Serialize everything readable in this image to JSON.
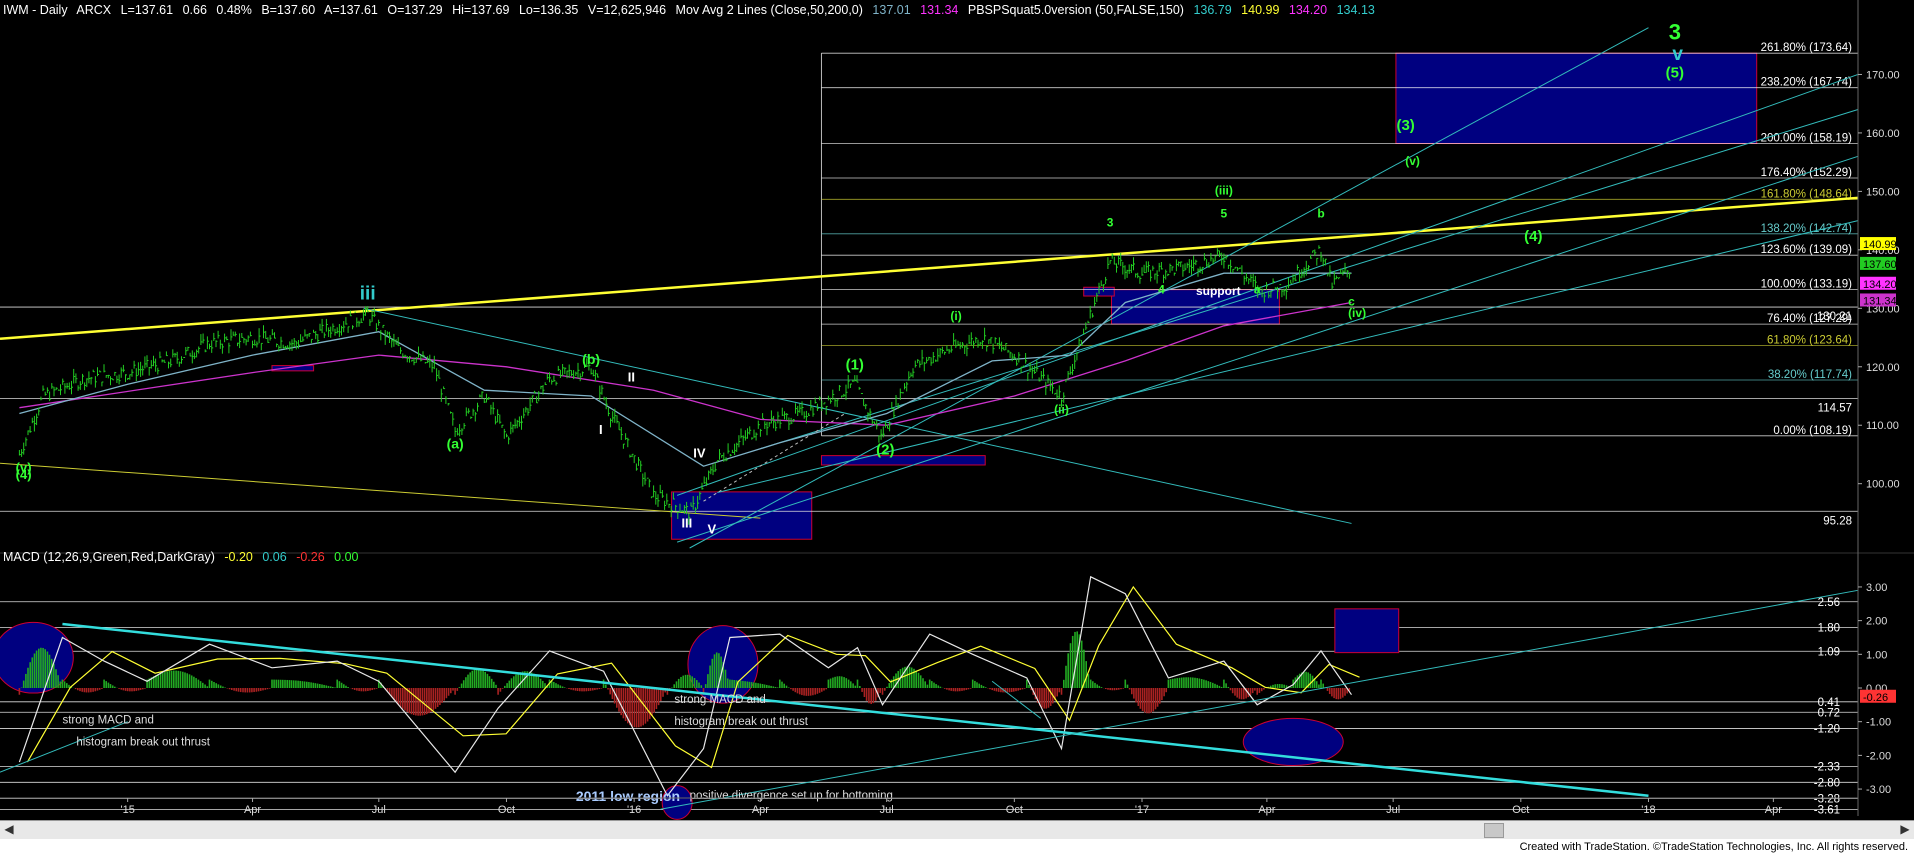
{
  "header": {
    "symbol": "IWM - Daily",
    "exchange": "ARCX",
    "last": "L=137.61",
    "change": "0.66",
    "pct": "0.48%",
    "bid": "B=137.60",
    "ask": "A=137.61",
    "open": "O=137.29",
    "high": "Hi=137.69",
    "low": "Lo=136.35",
    "volume": "V=12,625,946",
    "ma_title": "Mov Avg 2 Lines (Close,50,200,0)",
    "ma_v1": "137.01",
    "ma_v2": "131.34",
    "ind_title": "PBSPSquat5.0version (50,FALSE,150)",
    "ind_v1": "136.79",
    "ind_v2": "140.99",
    "ind_v3": "134.20",
    "ind_v4": "134.13"
  },
  "macd_header": {
    "title": "MACD (12,26,9,Green,Red,DarkGray)",
    "v1": "-0.20",
    "v2": "0.06",
    "v3": "-0.26",
    "v4": "0.00"
  },
  "footer": {
    "text": "Created with TradeStation. ©TradeStation Technologies, Inc. All rights reserved."
  },
  "colors": {
    "price": "#22cc22",
    "fib": "#ffffff",
    "trendline": "#ffff33",
    "channel": "#33bbbb",
    "ma50": "#7fb3c8",
    "ma200": "#cc33cc",
    "box_fill": "#000080",
    "box_stroke": "#cc0033",
    "label_green": "#33ff33",
    "macd_line": "#e8e8e8",
    "signal_line": "#ffff33",
    "hist_pos": "#22aa22",
    "hist_neg": "#aa2222"
  },
  "chart_data": [
    {
      "type": "candlestick",
      "title": "IWM - Daily",
      "x_ticks": [
        "'15",
        "Apr",
        "Jul",
        "Oct",
        "'16",
        "Apr",
        "Jul",
        "Oct",
        "'17",
        "Apr",
        "Jul",
        "Oct",
        "'18",
        "Apr"
      ],
      "y_ticks": [
        100,
        110,
        120,
        130,
        140,
        150,
        160,
        170
      ],
      "ylim": [
        89,
        180
      ],
      "close_path": [
        {
          "d": "2014-10-15",
          "v": 105
        },
        {
          "d": "2014-11-01",
          "v": 115
        },
        {
          "d": "2014-12-01",
          "v": 118
        },
        {
          "d": "2015-01-01",
          "v": 119
        },
        {
          "d": "2015-02-01",
          "v": 121
        },
        {
          "d": "2015-03-01",
          "v": 124
        },
        {
          "d": "2015-04-01",
          "v": 125
        },
        {
          "d": "2015-05-01",
          "v": 124
        },
        {
          "d": "2015-06-01",
          "v": 127
        },
        {
          "d": "2015-06-23",
          "v": 129
        },
        {
          "d": "2015-07-15",
          "v": 123
        },
        {
          "d": "2015-08-10",
          "v": 120
        },
        {
          "d": "2015-08-25",
          "v": 109
        },
        {
          "d": "2015-09-15",
          "v": 115
        },
        {
          "d": "2015-10-01",
          "v": 108
        },
        {
          "d": "2015-11-01",
          "v": 118
        },
        {
          "d": "2015-12-01",
          "v": 120
        },
        {
          "d": "2015-12-15",
          "v": 112
        },
        {
          "d": "2016-01-15",
          "v": 98
        },
        {
          "d": "2016-02-11",
          "v": 95
        },
        {
          "d": "2016-03-01",
          "v": 104
        },
        {
          "d": "2016-04-01",
          "v": 110
        },
        {
          "d": "2016-05-01",
          "v": 112
        },
        {
          "d": "2016-06-08",
          "v": 117
        },
        {
          "d": "2016-06-27",
          "v": 108
        },
        {
          "d": "2016-07-20",
          "v": 120
        },
        {
          "d": "2016-08-15",
          "v": 123
        },
        {
          "d": "2016-09-08",
          "v": 125
        },
        {
          "d": "2016-10-01",
          "v": 122
        },
        {
          "d": "2016-11-04",
          "v": 115
        },
        {
          "d": "2016-12-01",
          "v": 133
        },
        {
          "d": "2016-12-09",
          "v": 138
        },
        {
          "d": "2017-01-01",
          "v": 136
        },
        {
          "d": "2017-02-01",
          "v": 137
        },
        {
          "d": "2017-03-01",
          "v": 139
        },
        {
          "d": "2017-03-27",
          "v": 133
        },
        {
          "d": "2017-04-15",
          "v": 134
        },
        {
          "d": "2017-05-01",
          "v": 138
        },
        {
          "d": "2017-05-10",
          "v": 140
        },
        {
          "d": "2017-05-18",
          "v": 134
        },
        {
          "d": "2017-06-01",
          "v": 137
        }
      ],
      "fib_levels": [
        {
          "label": "261.80% (173.64)",
          "v": 173.64,
          "color": "#ffffff"
        },
        {
          "label": "238.20% (167.74)",
          "v": 167.74,
          "color": "#ffffff"
        },
        {
          "label": "200.00% (158.19)",
          "v": 158.19,
          "color": "#ffffff"
        },
        {
          "label": "176.40% (152.29)",
          "v": 152.29,
          "color": "#ffffff"
        },
        {
          "label": "161.80% (148.64)",
          "v": 148.64,
          "color": "#cccc33"
        },
        {
          "label": "138.20% (142.74)",
          "v": 142.74,
          "color": "#66cccc"
        },
        {
          "label": "123.60% (139.09)",
          "v": 139.09,
          "color": "#ffffff"
        },
        {
          "label": "100.00% (133.19)",
          "v": 133.19,
          "color": "#ffffff"
        },
        {
          "label": "76.40% (127.29)",
          "v": 127.29,
          "color": "#ffffff"
        },
        {
          "label": "61.80% (123.64)",
          "v": 123.64,
          "color": "#cccc33"
        },
        {
          "label": "38.20% (117.74)",
          "v": 117.74,
          "color": "#66cccc"
        },
        {
          "label": "0.00% (108.19)",
          "v": 108.19,
          "color": "#ffffff"
        }
      ],
      "horizontal_levels": [
        130.21,
        114.57,
        95.28
      ],
      "axis_tags": [
        {
          "text": "140.99",
          "v": 140.99,
          "bg": "#ffff00",
          "fg": "#000000"
        },
        {
          "text": "137.60",
          "v": 137.6,
          "bg": "#22cc22",
          "fg": "#000000"
        },
        {
          "text": "134.20",
          "v": 134.2,
          "bg": "#ff33ff",
          "fg": "#000000"
        },
        {
          "text": "131.34",
          "v": 131.34,
          "bg": "#cc33cc",
          "fg": "#000000"
        }
      ],
      "wave_labels": [
        {
          "text": "iii",
          "d": "2015-06-23",
          "v": 131.5,
          "color": "#33cccc",
          "size": 19
        },
        {
          "text": "(b)",
          "d": "2015-12-01",
          "v": 120.5,
          "color": "#33ff33",
          "size": 14
        },
        {
          "text": "(a)",
          "d": "2015-08-25",
          "v": 106,
          "color": "#33ff33",
          "size": 14
        },
        {
          "text": "I",
          "d": "2015-12-08",
          "v": 108.5,
          "color": "#ffffff",
          "size": 13
        },
        {
          "text": "II",
          "d": "2015-12-30",
          "v": 117.5,
          "color": "#ffffff",
          "size": 13
        },
        {
          "text": "IV",
          "d": "2016-02-17",
          "v": 104.5,
          "color": "#ffffff",
          "size": 13
        },
        {
          "text": "III",
          "d": "2016-02-08",
          "v": 92.5,
          "color": "#ffffff",
          "size": 13
        },
        {
          "text": "V",
          "d": "2016-02-26",
          "v": 91.5,
          "color": "#ffffff",
          "size": 13
        },
        {
          "text": "(1)",
          "d": "2016-06-08",
          "v": 119.5,
          "color": "#33ff33",
          "size": 15
        },
        {
          "text": "(2)",
          "d": "2016-06-30",
          "v": 105,
          "color": "#33ff33",
          "size": 15
        },
        {
          "text": "(i)",
          "d": "2016-08-20",
          "v": 128,
          "color": "#33ff33",
          "size": 12
        },
        {
          "text": "(ii)",
          "d": "2016-11-04",
          "v": 112,
          "color": "#33ff33",
          "size": 12
        },
        {
          "text": "3",
          "d": "2016-12-09",
          "v": 144,
          "color": "#33ff33",
          "size": 12
        },
        {
          "text": "4",
          "d": "2017-01-15",
          "v": 132.5,
          "color": "#33ff33",
          "size": 12
        },
        {
          "text": "5",
          "d": "2017-03-01",
          "v": 145.5,
          "color": "#33ff33",
          "size": 12
        },
        {
          "text": "(iii)",
          "d": "2017-03-01",
          "v": 149.5,
          "color": "#33ff33",
          "size": 12
        },
        {
          "text": "a",
          "d": "2017-03-25",
          "v": 132.5,
          "color": "#33ff33",
          "size": 12
        },
        {
          "text": "b",
          "d": "2017-05-10",
          "v": 145.5,
          "color": "#33ff33",
          "size": 12
        },
        {
          "text": "c",
          "d": "2017-06-01",
          "v": 130.5,
          "color": "#33ff33",
          "size": 12
        },
        {
          "text": "(iv)",
          "d": "2017-06-05",
          "v": 128.5,
          "color": "#33ff33",
          "size": 12
        },
        {
          "text": "(v)",
          "d": "2017-07-15",
          "v": 154.5,
          "color": "#33ff33",
          "size": 12
        },
        {
          "text": "(4)",
          "d": "2017-10-10",
          "v": 141.5,
          "color": "#33ff33",
          "size": 15
        },
        {
          "text": "(3)",
          "d": "2017-07-10",
          "v": 160.5,
          "color": "#33ff33",
          "size": 15
        },
        {
          "text": "(5)",
          "d": "2018-01-20",
          "v": 169.5,
          "color": "#33ff33",
          "size": 15
        },
        {
          "text": "v",
          "d": "2018-01-22",
          "v": 172.5,
          "color": "#33cccc",
          "size": 19
        },
        {
          "text": "3",
          "d": "2018-01-20",
          "v": 176,
          "color": "#33ff33",
          "size": 22
        },
        {
          "text": "support",
          "d": "2017-02-25",
          "v": 132.3,
          "color": "#ffffff",
          "size": 12
        },
        {
          "text": "(v)",
          "d": "2014-10-18",
          "v": 102,
          "color": "#33ff33",
          "size": 13
        },
        {
          "text": "(4)",
          "d": "2014-10-18",
          "v": 100.8,
          "color": "#33ff33",
          "size": 13
        }
      ],
      "boxes": [
        {
          "d1": "2017-07-03",
          "d2": "2018-03-20",
          "v1": 158.19,
          "v2": 173.64
        },
        {
          "d1": "2016-12-10",
          "d2": "2017-04-10",
          "v1": 127.3,
          "v2": 133.19
        },
        {
          "d1": "2016-11-20",
          "d2": "2016-12-12",
          "v1": 132.1,
          "v2": 133.6
        },
        {
          "d1": "2016-05-15",
          "d2": "2016-09-10",
          "v1": 103.2,
          "v2": 104.8
        },
        {
          "d1": "2016-01-28",
          "d2": "2016-05-08",
          "v1": 90.5,
          "v2": 98.6
        },
        {
          "d1": "2015-04-15",
          "d2": "2015-05-15",
          "v1": 119.3,
          "v2": 120.2
        }
      ]
    },
    {
      "type": "bar",
      "title": "MACD (12,26,9,Green,Red,DarkGray)",
      "y_ticks": [
        3.0,
        2.0,
        1.0,
        0.0,
        -1.0,
        -2.0,
        -3.0
      ],
      "ylim": [
        -3.8,
        3.8
      ],
      "levels": [
        {
          "label": "2.56",
          "v": 2.56
        },
        {
          "label": "1.80",
          "v": 1.8
        },
        {
          "label": "1.09",
          "v": 1.09
        },
        {
          "label": "0.41",
          "v": -0.41
        },
        {
          "label": "0.72",
          "v": -0.72
        },
        {
          "label": "-1.20",
          "v": -1.2
        },
        {
          "label": "-2.33",
          "v": -2.33
        },
        {
          "label": "-2.80",
          "v": -2.8
        },
        {
          "label": "-3.28",
          "v": -3.28
        },
        {
          "label": "-3.61",
          "v": -3.61
        }
      ],
      "macd_path": [
        {
          "d": "2014-10-15",
          "v": -2.2
        },
        {
          "d": "2014-11-15",
          "v": 1.5
        },
        {
          "d": "2014-12-15",
          "v": 0.8
        },
        {
          "d": "2015-01-15",
          "v": 0.2
        },
        {
          "d": "2015-03-01",
          "v": 1.3
        },
        {
          "d": "2015-04-15",
          "v": 0.6
        },
        {
          "d": "2015-06-01",
          "v": 0.8
        },
        {
          "d": "2015-07-01",
          "v": 0.2
        },
        {
          "d": "2015-08-25",
          "v": -2.5
        },
        {
          "d": "2015-09-25",
          "v": -0.6
        },
        {
          "d": "2015-11-01",
          "v": 1.1
        },
        {
          "d": "2015-12-10",
          "v": 0.5
        },
        {
          "d": "2016-01-25",
          "v": -3.2
        },
        {
          "d": "2016-02-20",
          "v": -1.8
        },
        {
          "d": "2016-03-10",
          "v": 1.5
        },
        {
          "d": "2016-04-15",
          "v": 1.6
        },
        {
          "d": "2016-05-20",
          "v": 0.6
        },
        {
          "d": "2016-06-10",
          "v": 1.2
        },
        {
          "d": "2016-06-28",
          "v": -0.5
        },
        {
          "d": "2016-08-01",
          "v": 1.6
        },
        {
          "d": "2016-09-01",
          "v": 1.0
        },
        {
          "d": "2016-10-10",
          "v": 0.3
        },
        {
          "d": "2016-11-04",
          "v": -1.8
        },
        {
          "d": "2016-11-25",
          "v": 3.3
        },
        {
          "d": "2016-12-20",
          "v": 2.8
        },
        {
          "d": "2017-01-20",
          "v": 0.3
        },
        {
          "d": "2017-03-01",
          "v": 0.8
        },
        {
          "d": "2017-03-25",
          "v": -0.5
        },
        {
          "d": "2017-04-20",
          "v": 0.1
        },
        {
          "d": "2017-05-10",
          "v": 1.1
        },
        {
          "d": "2017-06-01",
          "v": -0.2
        }
      ],
      "annotations": [
        {
          "text": "strong MACD and",
          "d": "2014-11-15",
          "v": -1.05
        },
        {
          "text": "histogram break out thrust",
          "d": "2014-11-25",
          "v": -1.7
        },
        {
          "text": "strong MACD  and",
          "d": "2016-01-30",
          "v": -0.45
        },
        {
          "text": "histogram break out thrust",
          "d": "2016-01-30",
          "v": -1.1
        },
        {
          "text": "2011 low region",
          "d": "2015-11-20",
          "v": -3.35
        },
        {
          "text": "positive divergence set up for bottoming",
          "d": "2016-02-10",
          "v": -3.3
        }
      ],
      "boxes": [
        {
          "d1": "2017-05-20",
          "d2": "2017-07-05",
          "v1": 1.05,
          "v2": 2.35
        }
      ],
      "ellipses": [
        {
          "d": "2014-10-25",
          "v": 0.9,
          "rd": 40,
          "rv": 1.05
        },
        {
          "d": "2016-03-05",
          "v": 0.7,
          "rd": 35,
          "rv": 1.15
        },
        {
          "d": "2017-04-20",
          "v": -1.6,
          "rd": 50,
          "rv": 0.7
        },
        {
          "d": "2016-02-01",
          "v": -3.4,
          "rd": 15,
          "rv": 0.5
        }
      ]
    }
  ]
}
